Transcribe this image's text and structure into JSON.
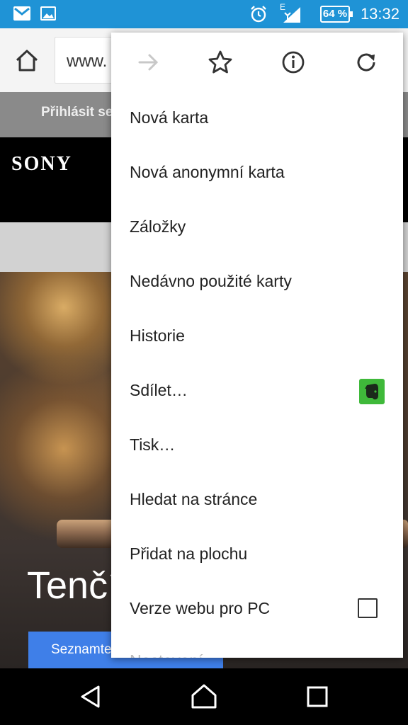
{
  "status_bar": {
    "time": "13:32",
    "battery": "64 %",
    "network": "E",
    "icons": [
      "gmail-icon",
      "gallery-icon",
      "alarm-icon",
      "signal-icon",
      "battery-icon"
    ]
  },
  "toolbar": {
    "url": "www.",
    "home_icon": "home-icon"
  },
  "page": {
    "login_text": "Přihlásit se",
    "brand": "SONY",
    "hero_title": "Tenčí",
    "hero_button": "Seznamte se"
  },
  "menu": {
    "top_icons": [
      "forward-icon",
      "star-icon",
      "info-icon",
      "reload-icon"
    ],
    "items": [
      {
        "label": "Nová karta"
      },
      {
        "label": "Nová anonymní karta"
      },
      {
        "label": "Záložky"
      },
      {
        "label": "Nedávno použité karty"
      },
      {
        "label": "Historie"
      },
      {
        "label": "Sdílet…",
        "icon": "evernote-icon"
      },
      {
        "label": "Tisk…"
      },
      {
        "label": "Hledat na stránce"
      },
      {
        "label": "Přidat na plochu"
      },
      {
        "label": "Verze webu pro PC",
        "checked": false
      },
      {
        "label": "Nastavení"
      }
    ]
  },
  "nav_bar": {
    "buttons": [
      "back-icon",
      "home-nav-icon",
      "recents-icon"
    ]
  },
  "colors": {
    "status_bar": "#1f93d6",
    "toolbar": "#f4f4f4",
    "hero_button": "#3f7fe8",
    "evernote": "#3fb93a"
  }
}
